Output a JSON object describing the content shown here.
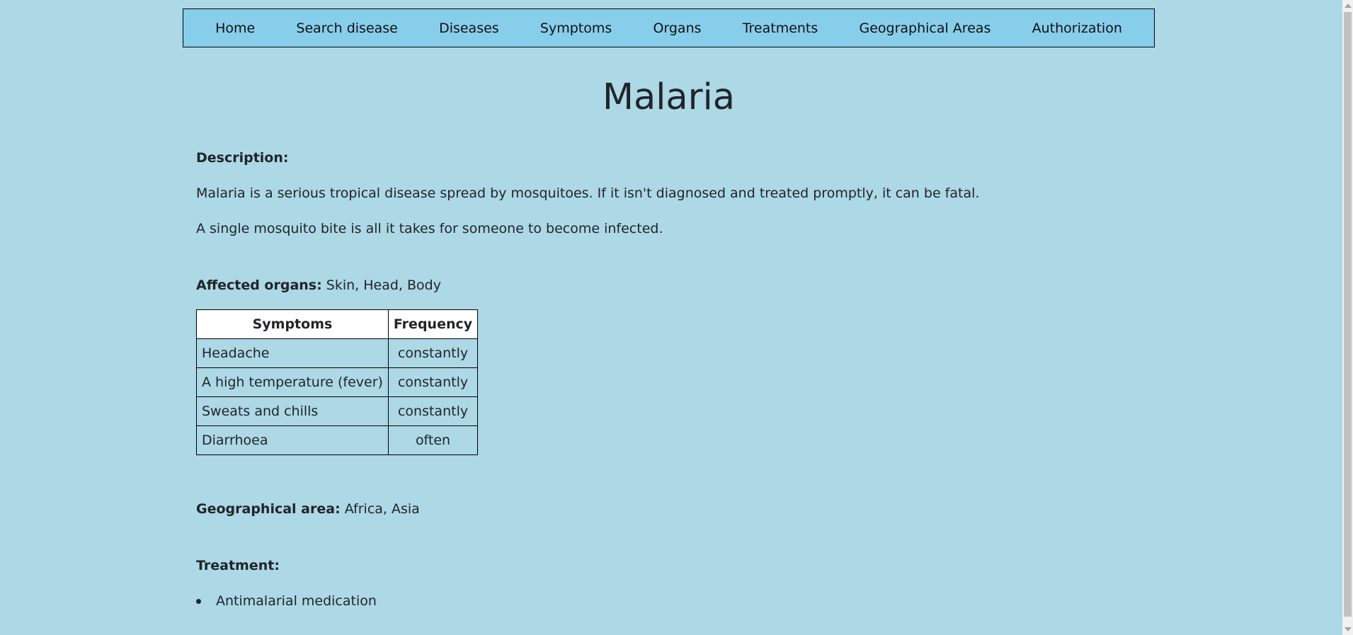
{
  "nav": {
    "items": [
      {
        "label": "Home"
      },
      {
        "label": "Search disease"
      },
      {
        "label": "Diseases"
      },
      {
        "label": "Symptoms"
      },
      {
        "label": "Organs"
      },
      {
        "label": "Treatments"
      },
      {
        "label": "Geographical Areas"
      },
      {
        "label": "Authorization"
      }
    ]
  },
  "disease": {
    "title": "Malaria",
    "description_label": "Description:",
    "description_paragraphs": [
      "Malaria is a serious tropical disease spread by mosquitoes. If it isn't diagnosed and treated promptly, it can be fatal.",
      "A single mosquito bite is all it takes for someone to become infected."
    ],
    "organs_label": "Affected organs:",
    "organs_value": "Skin, Head, Body",
    "symptoms_table": {
      "headers": [
        "Symptoms",
        "Frequency"
      ],
      "rows": [
        {
          "symptom": "Headache",
          "frequency": "constantly"
        },
        {
          "symptom": "A high temperature (fever)",
          "frequency": "constantly"
        },
        {
          "symptom": "Sweats and chills",
          "frequency": "constantly"
        },
        {
          "symptom": "Diarrhoea",
          "frequency": "often"
        }
      ]
    },
    "geo_label": "Geographical area:",
    "geo_value": "Africa, Asia",
    "treatment_label": "Treatment:",
    "treatments": [
      "Antimalarial medication"
    ]
  }
}
